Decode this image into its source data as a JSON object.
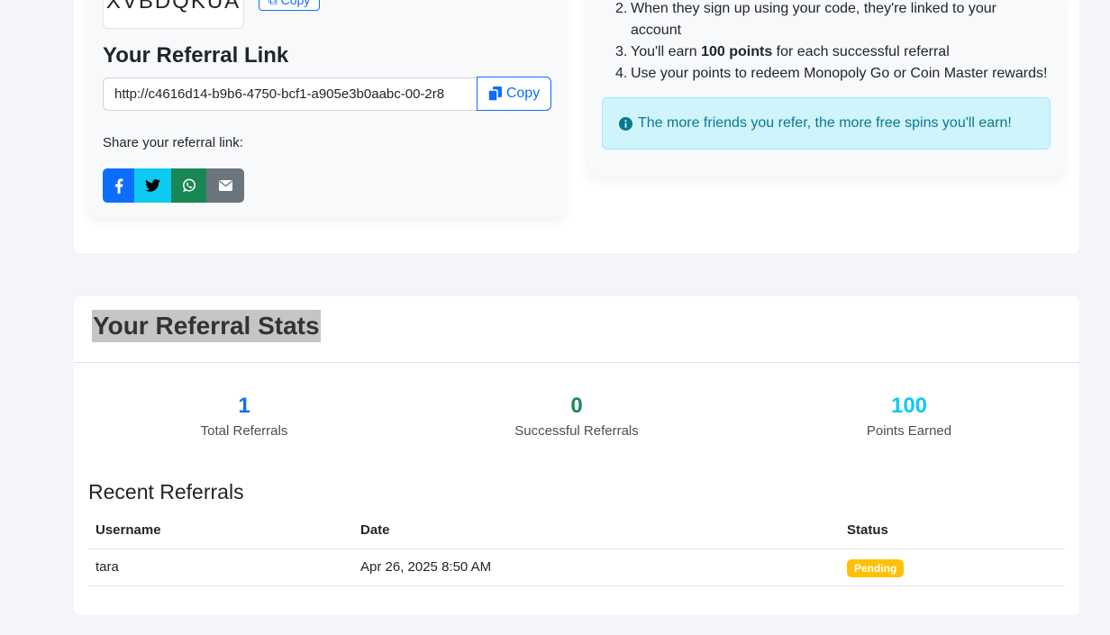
{
  "referral": {
    "code": "XVBDQKUA",
    "code_copy_label": "Copy",
    "link_title": "Your Referral Link",
    "link_value": "http://c4616d14-b9b6-4750-bcf1-a905e3b0aabc-00-2r8",
    "copy_label": "Copy",
    "share_label": "Share your referral link:"
  },
  "how_it_works": {
    "steps": [
      {
        "num": "2.",
        "line1": "When they sign up using your code, they're linked to your",
        "line2": "account"
      },
      {
        "num": "3.",
        "pre": "You'll earn ",
        "bold": "100 points",
        "post": " for each successful referral"
      },
      {
        "num": "4.",
        "text": "Use your points to redeem Monopoly Go or Coin Master rewards!"
      }
    ],
    "alert": "The more friends you refer, the more free spins you'll earn!"
  },
  "stats": {
    "title": "Your Referral Stats",
    "items": [
      {
        "value": "1",
        "label": "Total Referrals",
        "color": "#0d6efd"
      },
      {
        "value": "0",
        "label": "Successful Referrals",
        "color": "#198754"
      },
      {
        "value": "100",
        "label": "Points Earned",
        "color": "#0dcaf0"
      }
    ]
  },
  "recent": {
    "title": "Recent Referrals",
    "columns": [
      "Username",
      "Date",
      "Status"
    ],
    "rows": [
      {
        "username": "tara",
        "date": "Apr 26, 2025 8:50 AM",
        "status": "Pending"
      }
    ]
  },
  "icons": {
    "copy": "copy-icon",
    "facebook": "facebook-icon",
    "twitter": "twitter-icon",
    "whatsapp": "whatsapp-icon",
    "email": "envelope-icon",
    "info": "info-circle-icon"
  },
  "colors": {
    "primary": "#0d6efd",
    "facebook": "#0d6efd",
    "twitter": "#0dcaf0",
    "whatsapp": "#198754",
    "email": "#6c757d",
    "pending": "#ffc107"
  }
}
